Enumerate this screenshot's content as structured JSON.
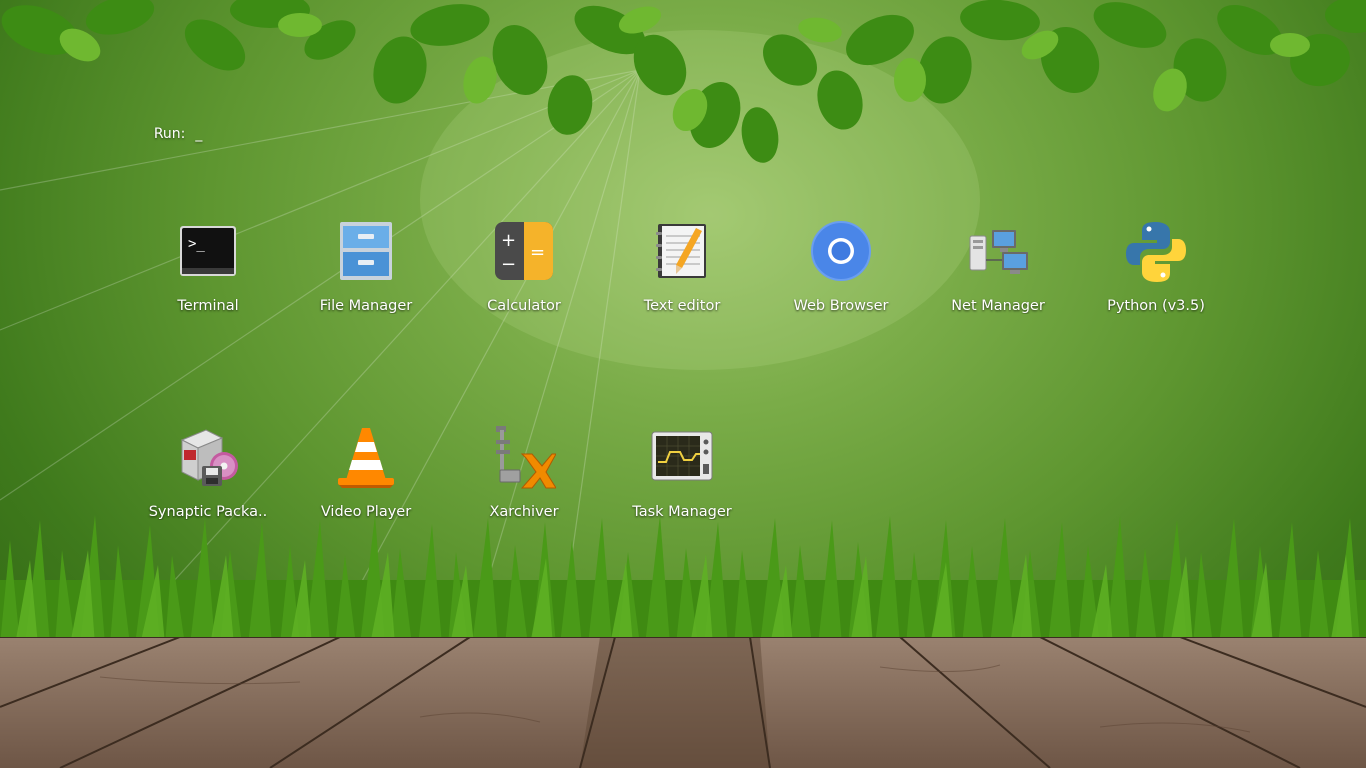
{
  "run_prompt": {
    "label": "Run:",
    "value": "_"
  },
  "launchers": [
    {
      "label": "Terminal",
      "icon": "terminal-icon"
    },
    {
      "label": "File Manager",
      "icon": "file-cabinet-icon"
    },
    {
      "label": "Calculator",
      "icon": "calculator-icon"
    },
    {
      "label": "Text editor",
      "icon": "notepad-pencil-icon"
    },
    {
      "label": "Web Browser",
      "icon": "chromium-icon"
    },
    {
      "label": "Net Manager",
      "icon": "network-computers-icon"
    },
    {
      "label": "Python (v3.5)",
      "icon": "python-logo-icon"
    },
    {
      "label": "Synaptic Packa..",
      "icon": "package-box-icon"
    },
    {
      "label": "Video Player",
      "icon": "traffic-cone-icon"
    },
    {
      "label": "Xarchiver",
      "icon": "archive-clamp-icon"
    },
    {
      "label": "Task Manager",
      "icon": "system-monitor-icon"
    }
  ],
  "colors": {
    "background": "#6aa03a",
    "label_text": "#ffffff",
    "floor": "#8a7260"
  }
}
